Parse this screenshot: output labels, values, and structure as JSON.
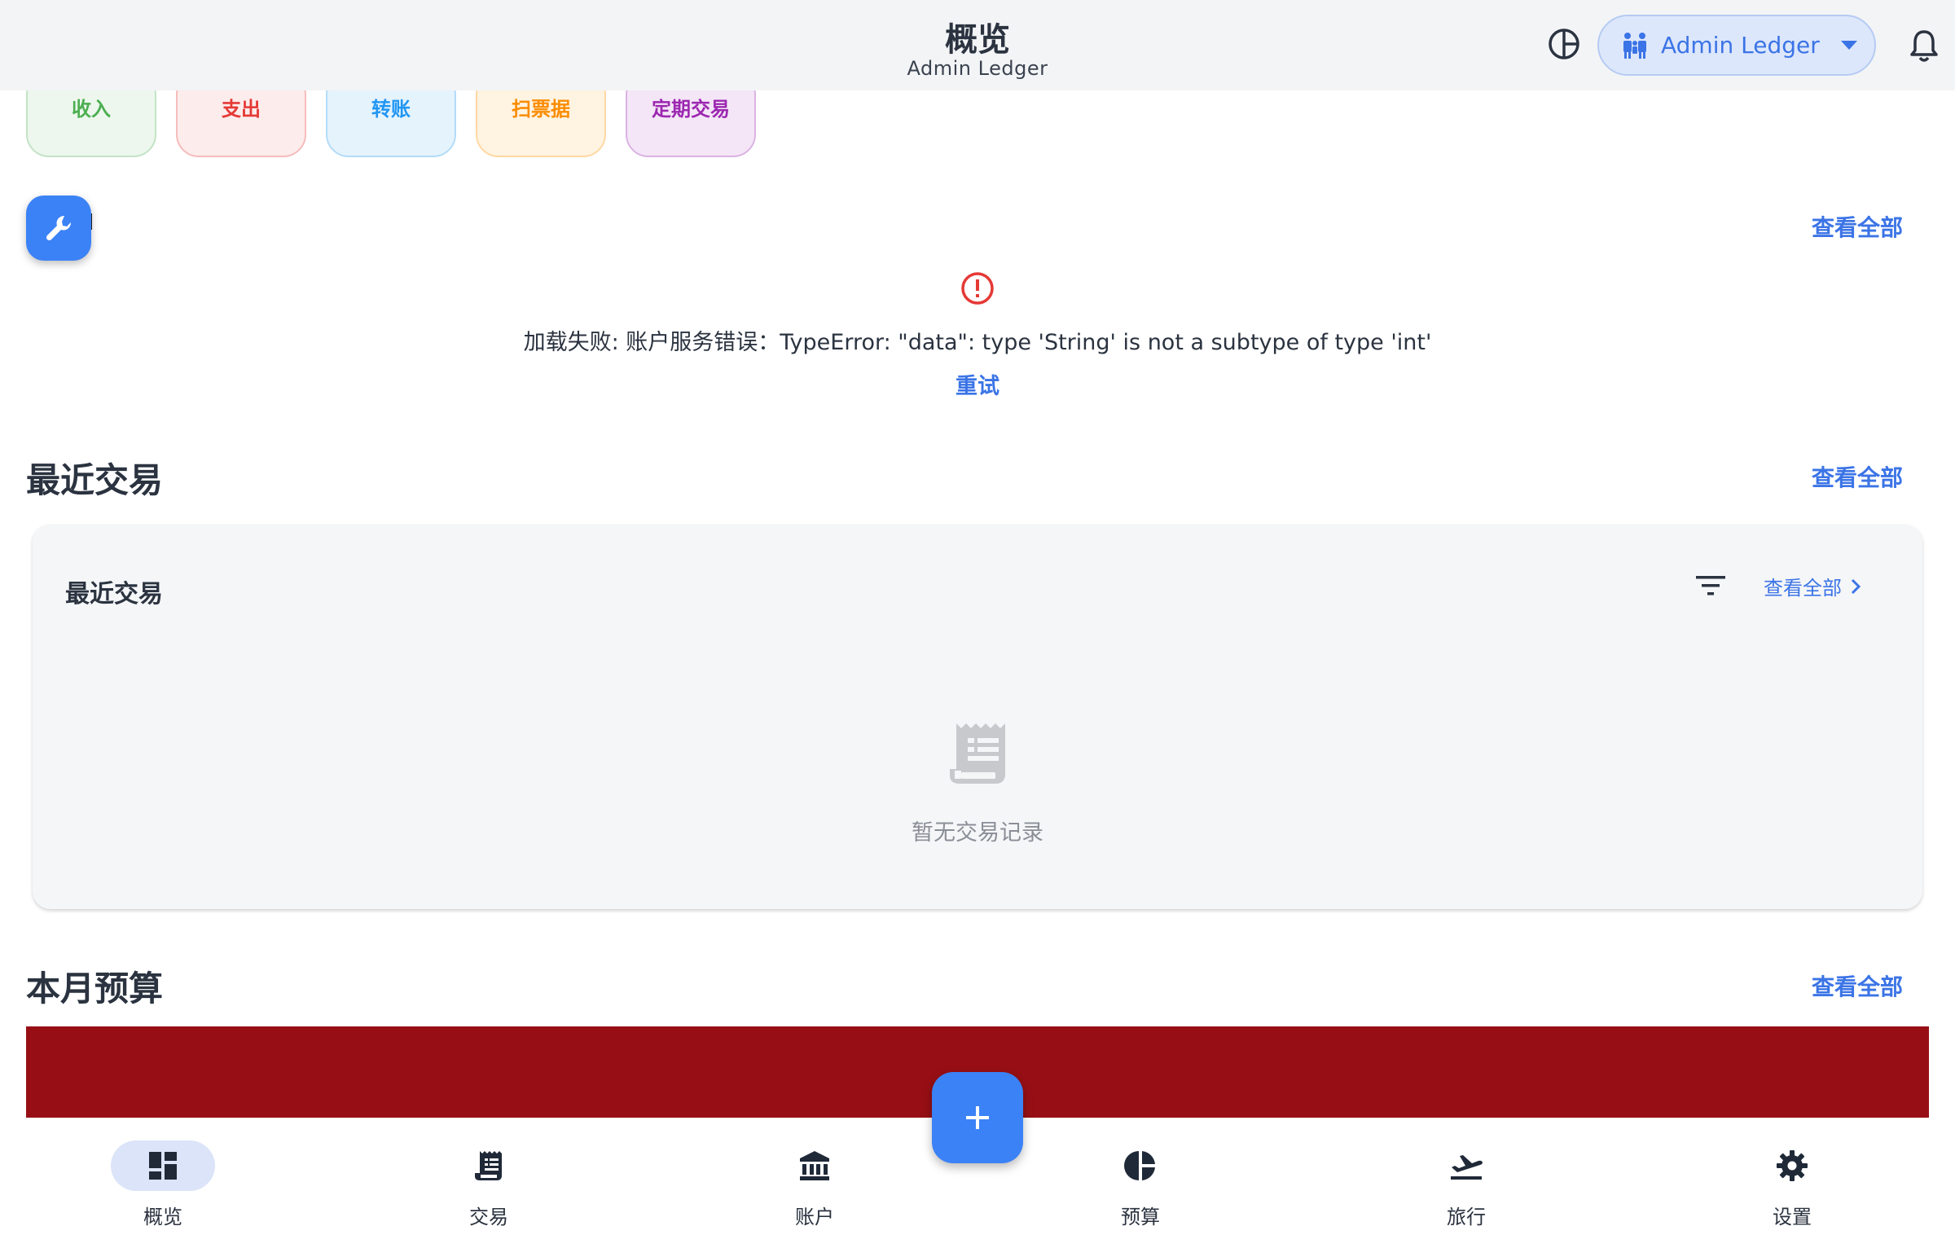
{
  "appbar": {
    "title": "概览",
    "subtitle": "Admin Ledger",
    "ledger_label": "Admin Ledger",
    "theme_icon": "pie-toggle-icon",
    "bell_icon": "bell-icon"
  },
  "quick_actions": [
    {
      "label": "收入",
      "color": "#4caf50"
    },
    {
      "label": "支出",
      "color": "#e53935"
    },
    {
      "label": "转账",
      "color": "#2196f3"
    },
    {
      "label": "扫票据",
      "color": "#fb8c00"
    },
    {
      "label": "定期交易",
      "color": "#9c27b0"
    }
  ],
  "accounts_section": {
    "view_all": "查看全部",
    "error_text": "加载失败: 账户服务错误：TypeError: \"data\": type 'String' is not a subtype of type 'int'",
    "retry": "重试"
  },
  "recent_section": {
    "title": "最近交易",
    "view_all": "查看全部",
    "card_title": "最近交易",
    "card_view_all": "查看全部",
    "empty_text": "暂无交易记录"
  },
  "budget_section": {
    "title": "本月预算",
    "view_all": "查看全部"
  },
  "bottom_nav": [
    {
      "label": "概览",
      "icon": "dashboard-icon",
      "active": true
    },
    {
      "label": "交易",
      "icon": "receipt-icon",
      "active": false
    },
    {
      "label": "账户",
      "icon": "bank-icon",
      "active": false
    },
    {
      "label": "预算",
      "icon": "pie-chart-icon",
      "active": false
    },
    {
      "label": "旅行",
      "icon": "flight-takeoff-icon",
      "active": false
    },
    {
      "label": "设置",
      "icon": "settings-icon",
      "active": false
    }
  ],
  "colors": {
    "accent": "#3b82f6",
    "link": "#3b74e6",
    "error": "#e53935",
    "budget_bar": "#970f14"
  }
}
